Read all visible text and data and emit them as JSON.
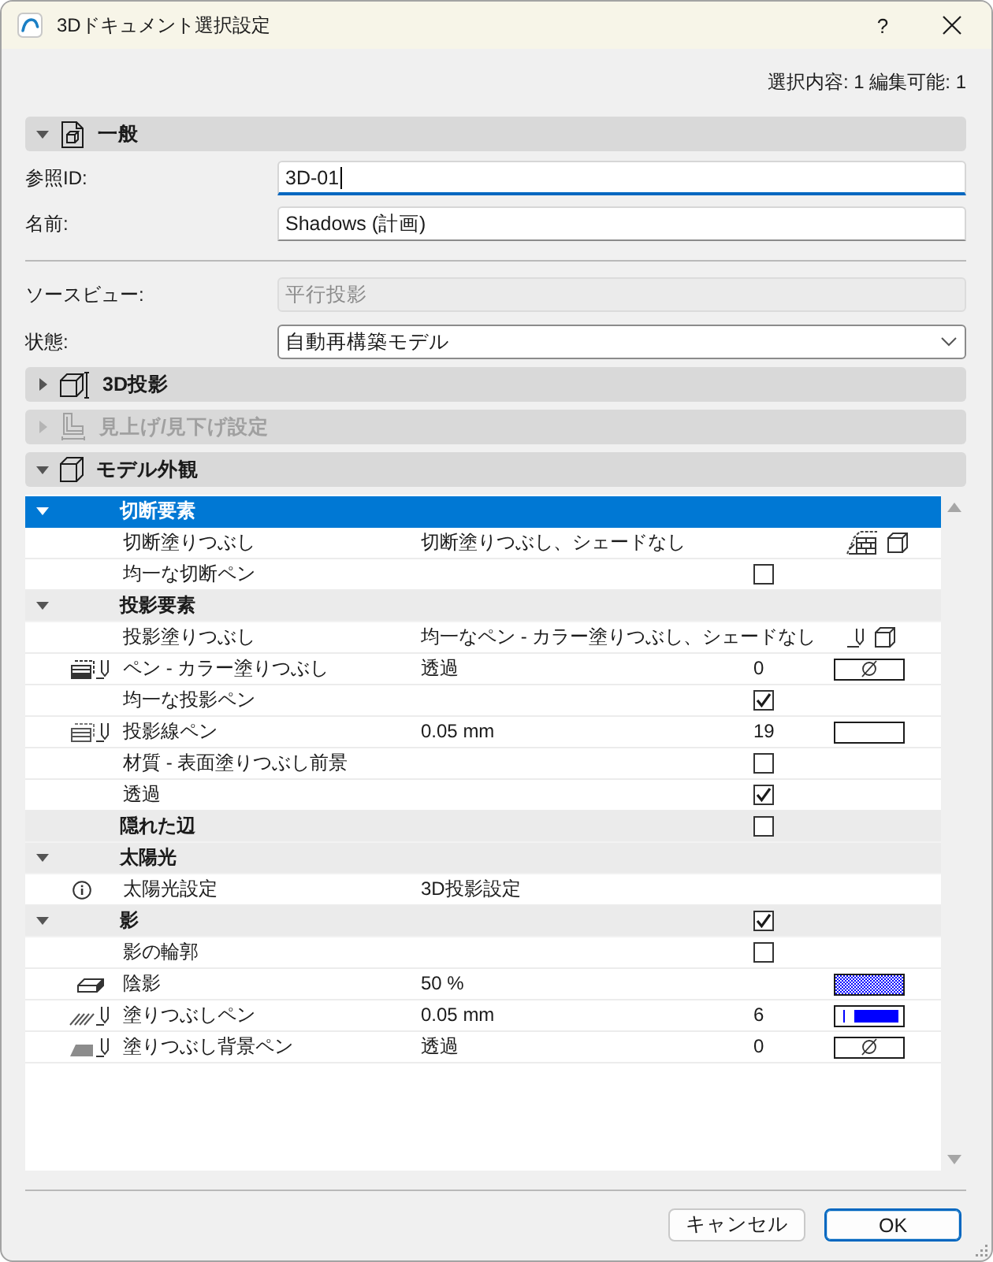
{
  "window": {
    "title": "3Dドキュメント選択設定",
    "help_label": "?"
  },
  "selection_info": "選択内容: 1 編集可能: 1",
  "sections": [
    {
      "kind": "general",
      "title": "一般",
      "expanded": true,
      "disabled": false,
      "fields": [
        {
          "kind": "text",
          "label": "参照ID:",
          "value": "3D-01",
          "focused": true
        },
        {
          "kind": "text",
          "label": "名前:",
          "value": "Shadows (計画)",
          "focused": false
        }
      ],
      "source_fields": [
        {
          "kind": "readonly",
          "label": "ソースビュー:",
          "value": "平行投影"
        },
        {
          "kind": "dropdown",
          "label": "状態:",
          "value": "自動再構築モデル"
        }
      ]
    },
    {
      "kind": "projection",
      "title": "3D投影",
      "expanded": false,
      "disabled": false
    },
    {
      "kind": "elevation",
      "title": "見上げ/見下げ設定",
      "expanded": false,
      "disabled": true
    },
    {
      "kind": "appearance",
      "title": "モデル外観",
      "expanded": true,
      "disabled": false,
      "rows": [
        {
          "kind": "group",
          "label": "切断要素",
          "expanded": true,
          "selected": true,
          "children": [
            {
              "kind": "cutsummary",
              "label": "切断塗りつぶし",
              "value": "切断塗りつぶし、シェードなし",
              "selected": false
            },
            {
              "kind": "check",
              "label": "均一な切断ペン",
              "checked": false,
              "selected": false
            }
          ]
        },
        {
          "kind": "group",
          "label": "投影要素",
          "expanded": true,
          "selected": false,
          "children": [
            {
              "kind": "projsummary",
              "label": "投影塗りつぶし",
              "value": "均一なペン - カラー塗りつぶし、シェードなし",
              "selected": false
            },
            {
              "kind": "fillpen",
              "label": "ペン - カラー塗りつぶし",
              "value": "透過",
              "pen": "0",
              "swatch": {
                "kind": "none"
              },
              "selected": false
            },
            {
              "kind": "check",
              "label": "均一な投影ペン",
              "checked": true,
              "selected": false
            },
            {
              "kind": "linepen",
              "label": "投影線ペン",
              "value": "0.05 mm",
              "pen": "19",
              "swatch": {
                "kind": "solid",
                "color": "#ffffff"
              },
              "selected": false
            },
            {
              "kind": "check",
              "label": "材質 - 表面塗りつぶし前景",
              "checked": false,
              "selected": false
            },
            {
              "kind": "check",
              "label": "透過",
              "checked": true,
              "selected": false
            }
          ]
        },
        {
          "kind": "group",
          "label": "隠れた辺",
          "checked": false,
          "selected": false
        },
        {
          "kind": "group",
          "label": "太陽光",
          "expanded": true,
          "selected": false,
          "children": [
            {
              "kind": "info",
              "label": "太陽光設定",
              "value": "3D投影設定",
              "selected": false
            }
          ]
        },
        {
          "kind": "group",
          "label": "影",
          "expanded": true,
          "checked": true,
          "selected": false,
          "children": [
            {
              "kind": "check",
              "label": "影の輪郭",
              "checked": false,
              "selected": false
            },
            {
              "kind": "shade",
              "label": "陰影",
              "value": "50 %",
              "swatch": {
                "kind": "hatch",
                "color": "#0000ff"
              },
              "selected": false
            },
            {
              "kind": "hatchpen",
              "label": "塗りつぶしペン",
              "value": "0.05 mm",
              "pen": "6",
              "swatch": {
                "kind": "line",
                "color": "#0000ff"
              },
              "selected": false
            },
            {
              "kind": "bgpen",
              "label": "塗りつぶし背景ペン",
              "value": "透過",
              "pen": "0",
              "swatch": {
                "kind": "none"
              },
              "selected": false
            }
          ]
        }
      ]
    }
  ],
  "buttons": [
    {
      "label": "キャンセル",
      "default": false
    },
    {
      "label": "OK",
      "default": true
    }
  ]
}
